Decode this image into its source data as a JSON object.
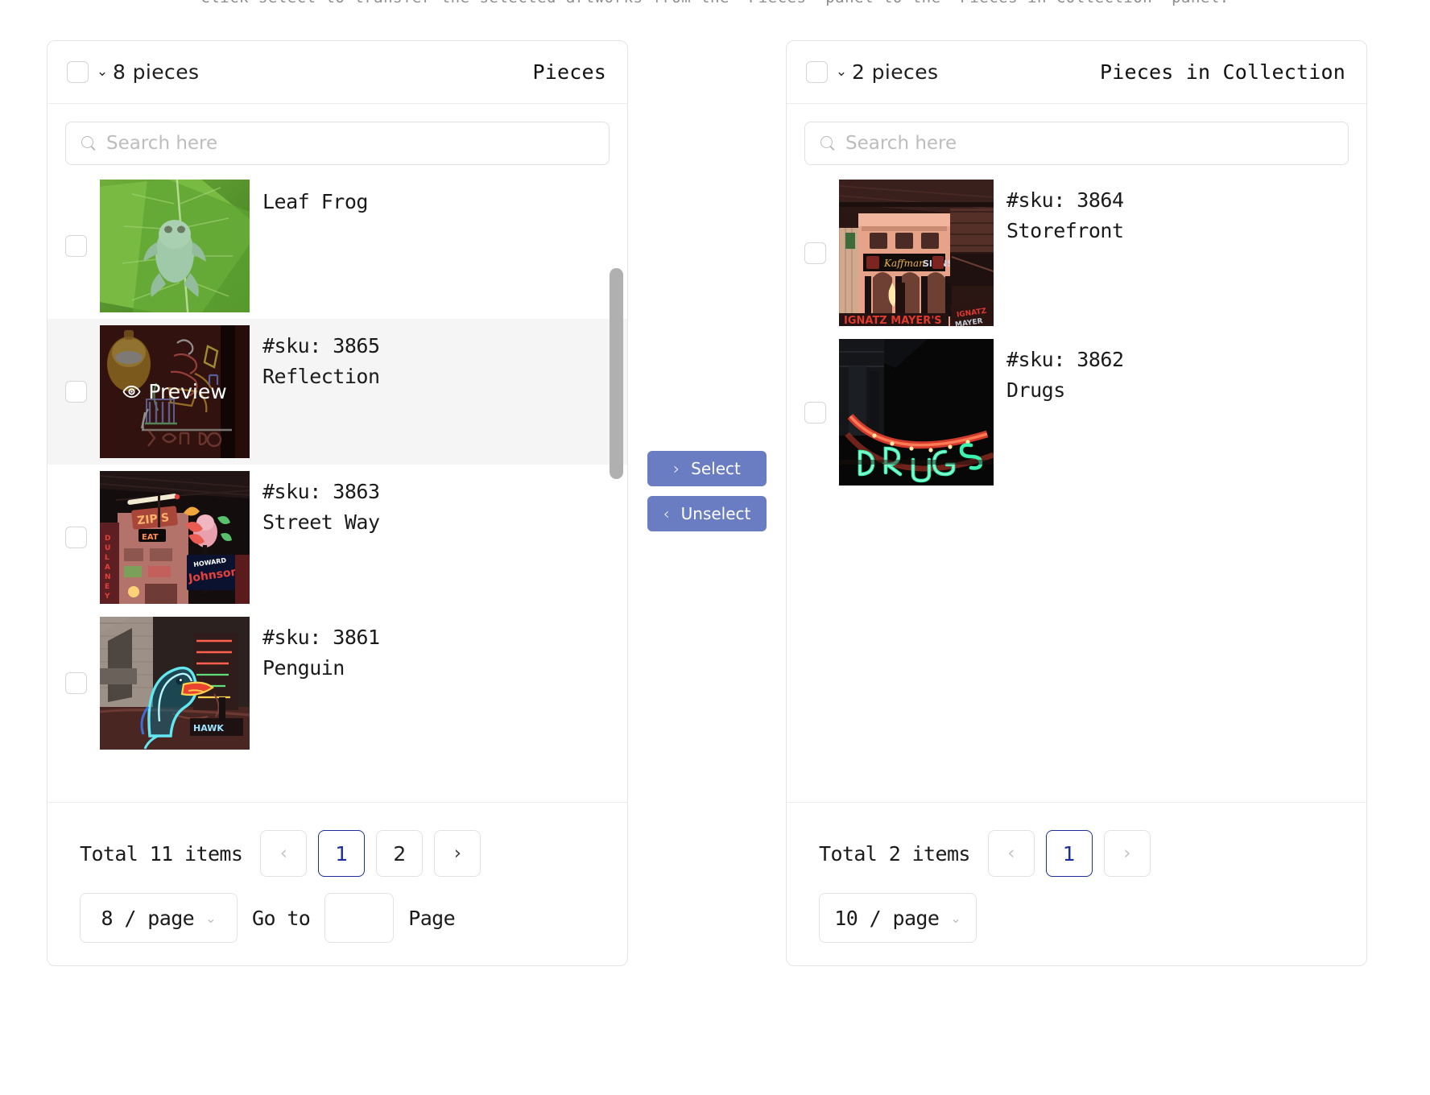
{
  "instruction": "Click select to transfer the selected artworks from the 'Pieces' panel to the 'Pieces in Collection' panel.",
  "accent_color": "#6a7cc2",
  "active_page_color": "#1b2ea0",
  "source_panel": {
    "title": "Pieces",
    "header_count": "8 pieces",
    "search_placeholder": "Search here",
    "items": [
      {
        "sku": "",
        "name": "Leaf Frog",
        "image": "leaf-frog",
        "hovered": false,
        "preview_label": ""
      },
      {
        "sku": "#sku: 3865",
        "name": "Reflection",
        "image": "reflection-neon",
        "hovered": true,
        "preview_label": "Preview"
      },
      {
        "sku": "#sku: 3863",
        "name": "Street Way",
        "image": "street-way-neon",
        "hovered": false,
        "preview_label": ""
      },
      {
        "sku": "#sku: 3861",
        "name": "Penguin",
        "image": "penguin-neon",
        "hovered": false,
        "preview_label": ""
      }
    ],
    "pagination": {
      "total_text": "Total 11 items",
      "prev_label": "‹",
      "next_label": "›",
      "pages": [
        "1",
        "2"
      ],
      "active_page": "1",
      "page_size": "8 / page",
      "goto_label": "Go to",
      "goto_value": "",
      "page_label": "Page"
    }
  },
  "target_panel": {
    "title": "Pieces in Collection",
    "header_count": "2 pieces",
    "search_placeholder": "Search here",
    "items": [
      {
        "sku": "#sku: 3864",
        "name": "Storefront",
        "image": "storefront-neon",
        "hovered": false,
        "preview_label": ""
      },
      {
        "sku": "#sku: 3862",
        "name": "Drugs",
        "image": "drugs-neon",
        "hovered": false,
        "preview_label": ""
      }
    ],
    "pagination": {
      "total_text": "Total 2 items",
      "prev_label": "‹",
      "next_label": "›",
      "pages": [
        "1"
      ],
      "active_page": "1",
      "page_size": "10 / page"
    }
  },
  "transfer_buttons": {
    "select_label": "Select",
    "select_icon": "›",
    "unselect_label": "Unselect",
    "unselect_icon": "‹"
  }
}
